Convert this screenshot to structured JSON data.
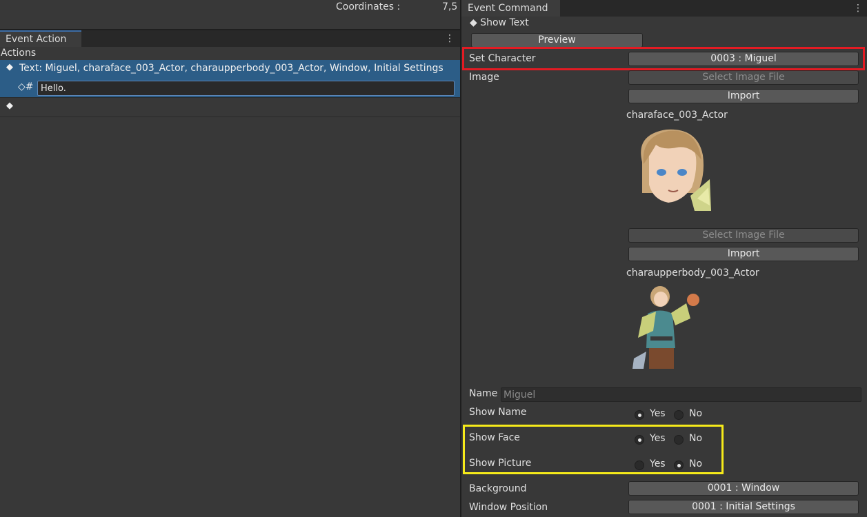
{
  "left": {
    "coordinates_label": "Coordinates :",
    "coordinates_value": "7,5",
    "tab_title": "Event Action",
    "kebab": "⋮",
    "actions_label": "Actions",
    "rows": [
      {
        "bullet": "◆",
        "text": "Text: Miguel, charaface_003_Actor, charaupperbody_003_Actor, Window, Initial Settings"
      },
      {
        "prefix": "◇#",
        "input_value": "Hello."
      },
      {
        "bullet": "◆"
      }
    ]
  },
  "right": {
    "tab_title": "Event Command",
    "kebab": "⋮",
    "command_title": "◆ Show Text",
    "preview_label": "Preview",
    "set_character_label": "Set Character",
    "set_character_value": "0003 : Miguel",
    "image_label": "Image",
    "select_image_label": "Select Image File",
    "import_label": "Import",
    "face_filename": "charaface_003_Actor",
    "body_filename": "charaupperbody_003_Actor",
    "name_label": "Name",
    "name_value": "Miguel",
    "yes_label": "Yes",
    "no_label": "No",
    "show_name_label": "Show Name",
    "show_face_label": "Show Face",
    "show_picture_label": "Show Picture",
    "show_name": "yes",
    "show_face": "yes",
    "show_picture": "no",
    "background_label": "Background",
    "background_value": "0001 : Window",
    "window_position_label": "Window Position",
    "window_position_value": "0001 : Initial Settings"
  },
  "colors": {
    "selection": "#2c5d87",
    "highlight_red": "#e31b23",
    "highlight_yellow": "#f6ea1a",
    "panel": "#383838"
  },
  "icons": [
    "kebab-menu-icon",
    "diamond-bullet-icon"
  ]
}
